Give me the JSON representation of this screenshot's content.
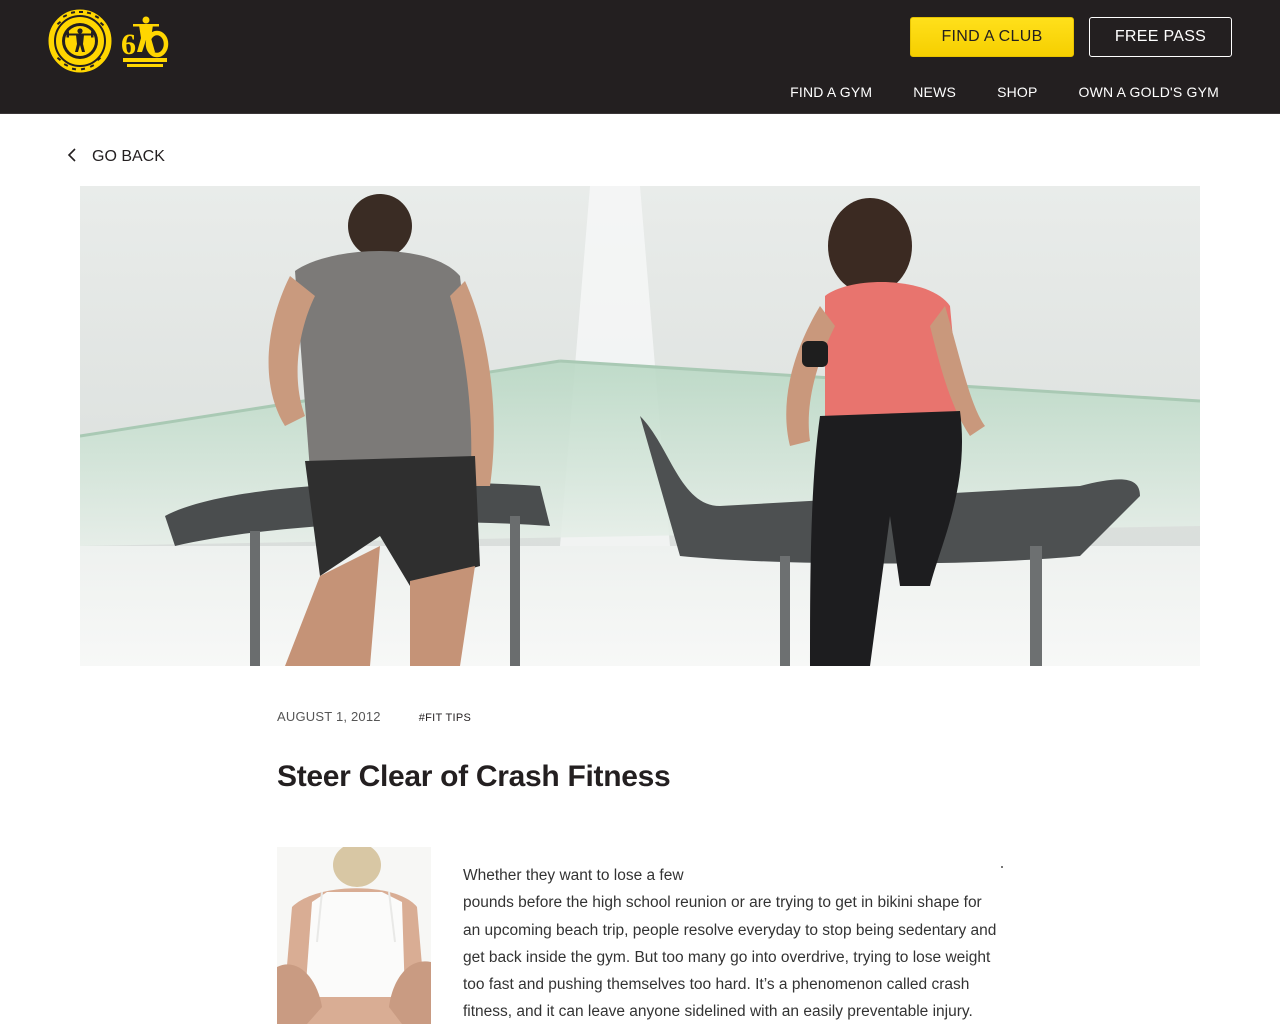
{
  "header": {
    "logo_text": "GOLD'S GYM",
    "anniversary_logo_text": "60 GOLD'S GYM",
    "find_club_label": "FIND A CLUB",
    "free_pass_label": "FREE PASS",
    "nav": [
      "FIND A GYM",
      "NEWS",
      "SHOP",
      "OWN A GOLD'S GYM"
    ]
  },
  "go_back_label": "GO BACK",
  "hero": {
    "icon": "photo-two-people-running-on-treadmills"
  },
  "article": {
    "date": "AUGUST 1, 2012",
    "tag": "#FIT TIPS",
    "title": "Steer Clear of Crash Fitness",
    "thumbnail_icon": "photo-woman-back-pain",
    "paragraph_first_line": "Whether they want to lose a few",
    "paragraph_rest": "pounds before the high school reunion or are trying to get in bikini shape for an upcoming beach trip, people resolve everyday to stop being sedentary and get back inside the gym. But too many go into overdrive, trying to lose weight too fast and pushing themselves too hard. It’s a phenomenon called crash fitness, and it can leave anyone sidelined with an easily preventable injury."
  },
  "colors": {
    "header_bg": "#231f20",
    "brand_yellow": "#ffd600",
    "text_dark": "#231f20"
  }
}
